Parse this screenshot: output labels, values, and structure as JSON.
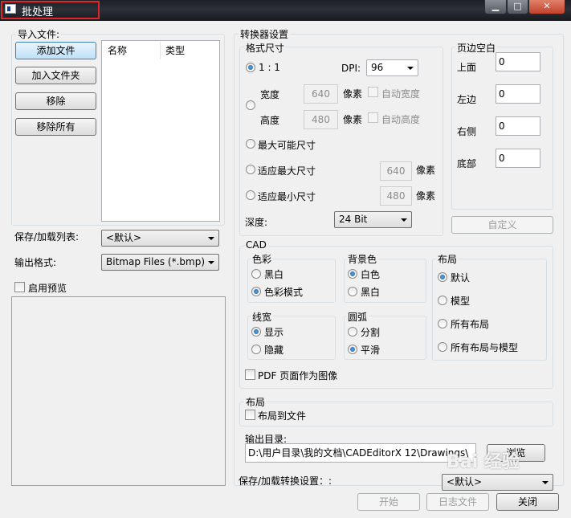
{
  "window": {
    "title": "批处理"
  },
  "import": {
    "title": "导入文件:",
    "buttons": {
      "add_file": "添加文件",
      "add_folder": "加入文件夹",
      "remove": "移除",
      "remove_all": "移除所有"
    },
    "columns": [
      "名称",
      "类型"
    ]
  },
  "list_file": {
    "label": "保存/加载列表:",
    "value": "<默认>"
  },
  "output_format": {
    "label": "输出格式:",
    "value": "Bitmap Files (*.bmp)"
  },
  "preview": {
    "label": "启用预览",
    "checked": false
  },
  "converter": {
    "title": "转换器设置",
    "format_size": {
      "title": "格式尺寸",
      "ratio": "1 : 1",
      "dpi_label": "DPI:",
      "dpi_value": "96",
      "width_label": "宽度",
      "width_value": "640",
      "height_label": "高度",
      "height_value": "480",
      "pixel_unit": "像素",
      "auto_width": "自动宽度",
      "auto_height": "自动高度",
      "max_possible": "最大可能尺寸",
      "fit_max": "适应最大尺寸",
      "fit_max_value": "640",
      "fit_min": "适应最小尺寸",
      "fit_min_value": "480",
      "depth_label": "深度:",
      "depth_value": "24 Bit"
    },
    "margins": {
      "title": "页边空白",
      "top_label": "上面",
      "top_value": "0",
      "left_label": "左边",
      "left_value": "0",
      "right_label": "右侧",
      "right_value": "0",
      "bottom_label": "底部",
      "bottom_value": "0",
      "custom_button": "自定义"
    },
    "cad": {
      "title": "CAD",
      "color": {
        "title": "色彩",
        "bw": "黑白",
        "color_mode": "色彩模式"
      },
      "background": {
        "title": "背景色",
        "white": "白色",
        "black": "黑白"
      },
      "line_width": {
        "title": "线宽",
        "show": "显示",
        "hide": "隐藏"
      },
      "arc": {
        "title": "圆弧",
        "split": "分割",
        "smooth": "平滑"
      },
      "layout": {
        "title": "布局",
        "default": "默认",
        "model": "模型",
        "all_layouts": "所有布局",
        "all_layouts_model": "所有布局与模型"
      },
      "pdf_as_image": "PDF 页面作为图像"
    },
    "layout_group": {
      "title": "布局",
      "layout_to_file": "布局到文件"
    },
    "output_dir": {
      "label": "输出目录:",
      "value": "D:\\用户目录\\我的文档\\CADEditorX 12\\Drawings\\",
      "browse": "浏览"
    },
    "save_settings": {
      "label": "保存/加载转换设置：:",
      "value": "<默认>"
    }
  },
  "footer": {
    "start": "开始",
    "log": "日志文件",
    "close": "关闭"
  },
  "watermark": "Bai 经验"
}
